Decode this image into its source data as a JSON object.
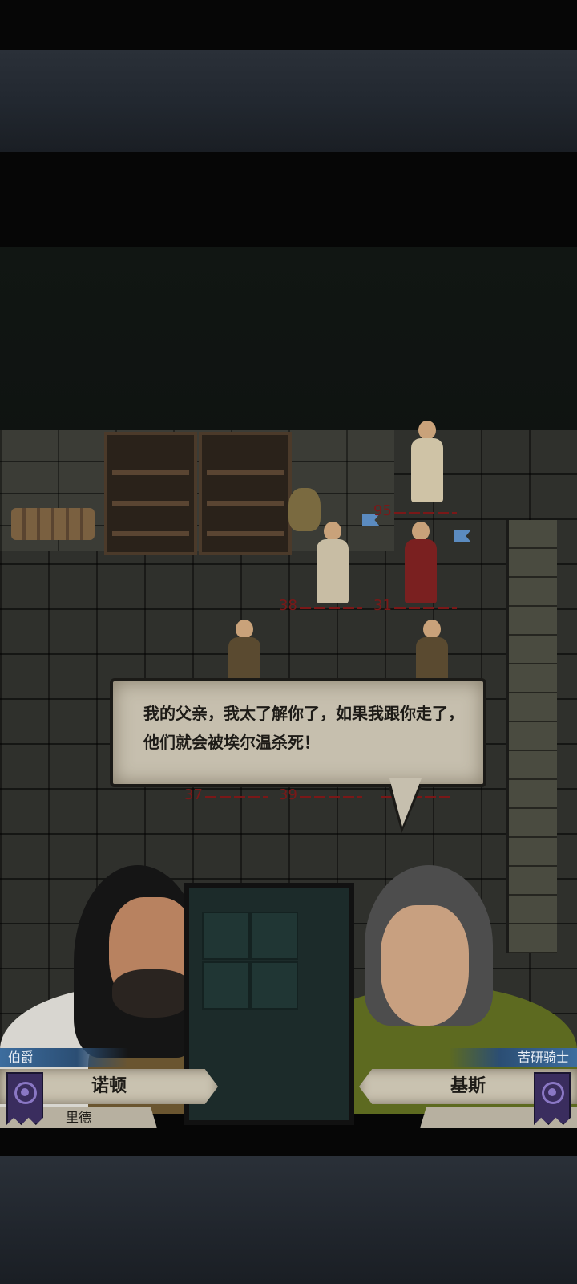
{
  "dialog": {
    "text": "我的父亲，我太了解你了，如果我跟你走了，他们就会被埃尔温杀死！"
  },
  "units": [
    {
      "hp": "95"
    },
    {
      "hp": "38"
    },
    {
      "hp": "31"
    },
    {
      "hp": "37"
    },
    {
      "hp": "39"
    }
  ],
  "left_speaker": {
    "title": "伯爵",
    "name": "诺顿",
    "subname": "里德",
    "emblem": "house-sigil-icon"
  },
  "right_speaker": {
    "title": "苦研骑士",
    "name": "基斯",
    "emblem": "house-sigil-icon"
  },
  "colors": {
    "hp_text": "#7a1818",
    "title_tag": "#3d6d9e",
    "parchment": "#c6bfae",
    "emblem": "#3a2d5e"
  }
}
